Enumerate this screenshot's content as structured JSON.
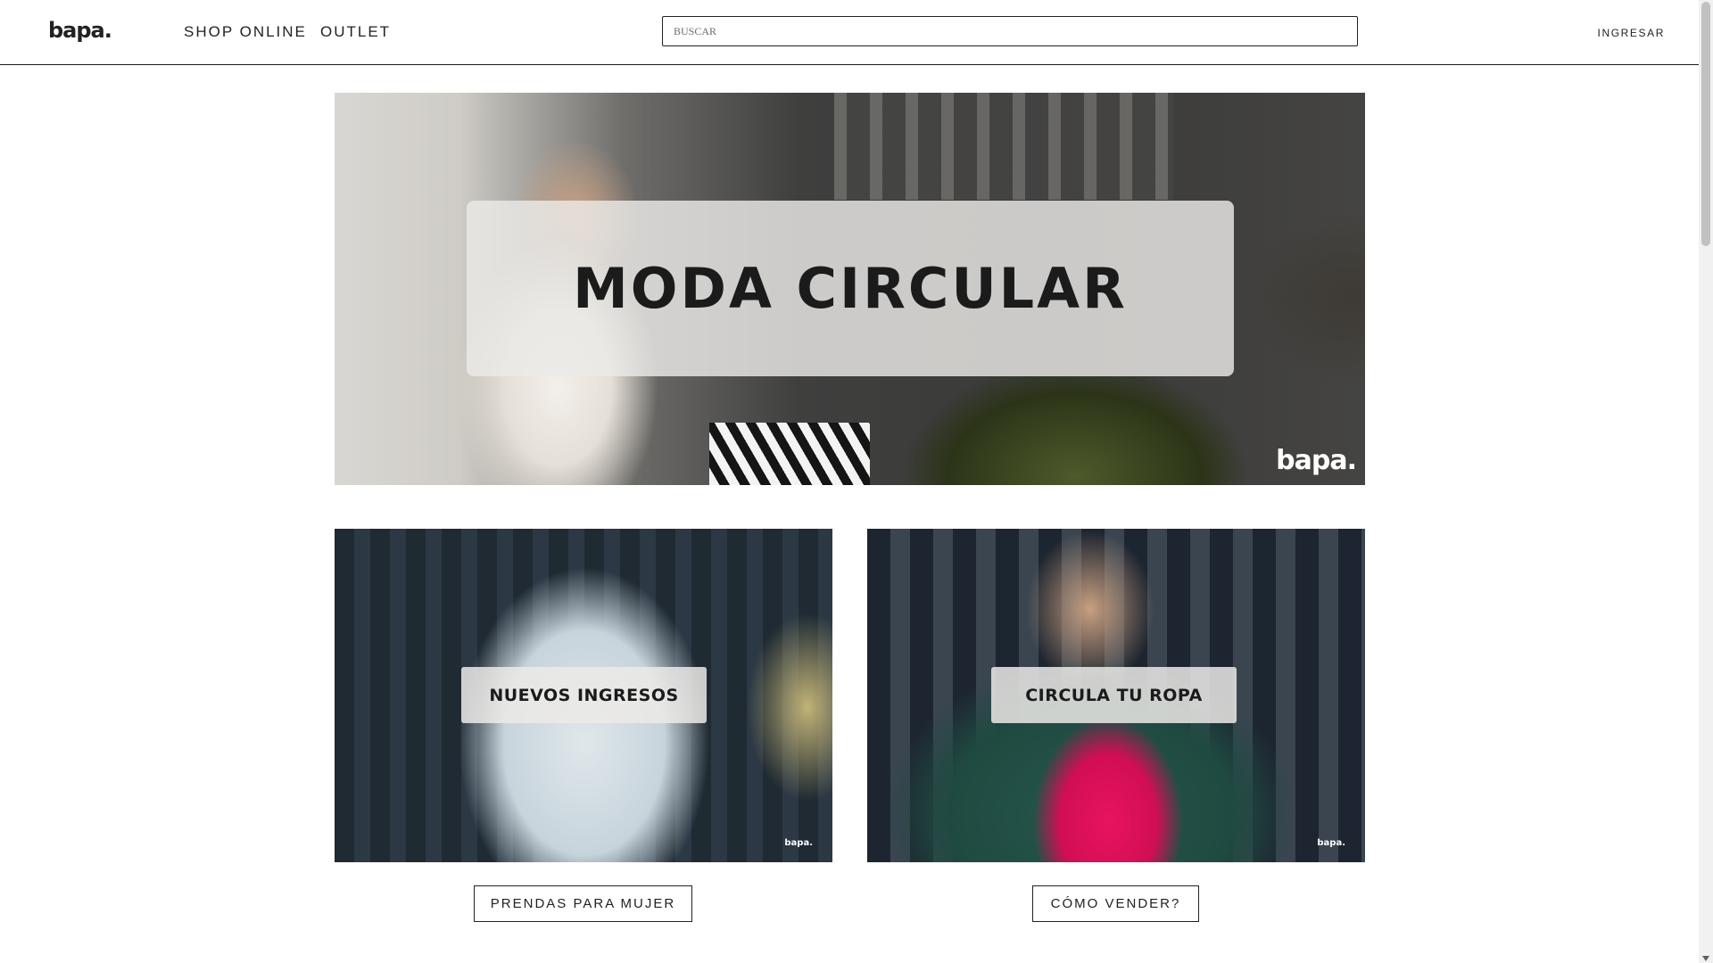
{
  "header": {
    "logo": "bapa.",
    "nav": [
      {
        "label": "SHOP ONLINE"
      },
      {
        "label": "OUTLET"
      }
    ],
    "search": {
      "placeholder": "BUSCAR",
      "value": ""
    },
    "login_label": "INGRESAR"
  },
  "hero": {
    "title": "MODA CIRCULAR",
    "brand_mark": "bapa."
  },
  "cards": [
    {
      "title": "NUEVOS INGRESOS",
      "brand_mark": "bapa.",
      "button_label": "PRENDAS PARA MUJER"
    },
    {
      "title": "CIRCULA TU ROPA",
      "brand_mark": "bapa.",
      "button_label": "CÓMO VENDER?"
    }
  ],
  "colors": {
    "accent": "#222222",
    "background": "#ffffff",
    "magenta": "#e8135f",
    "green": "#26574c"
  }
}
